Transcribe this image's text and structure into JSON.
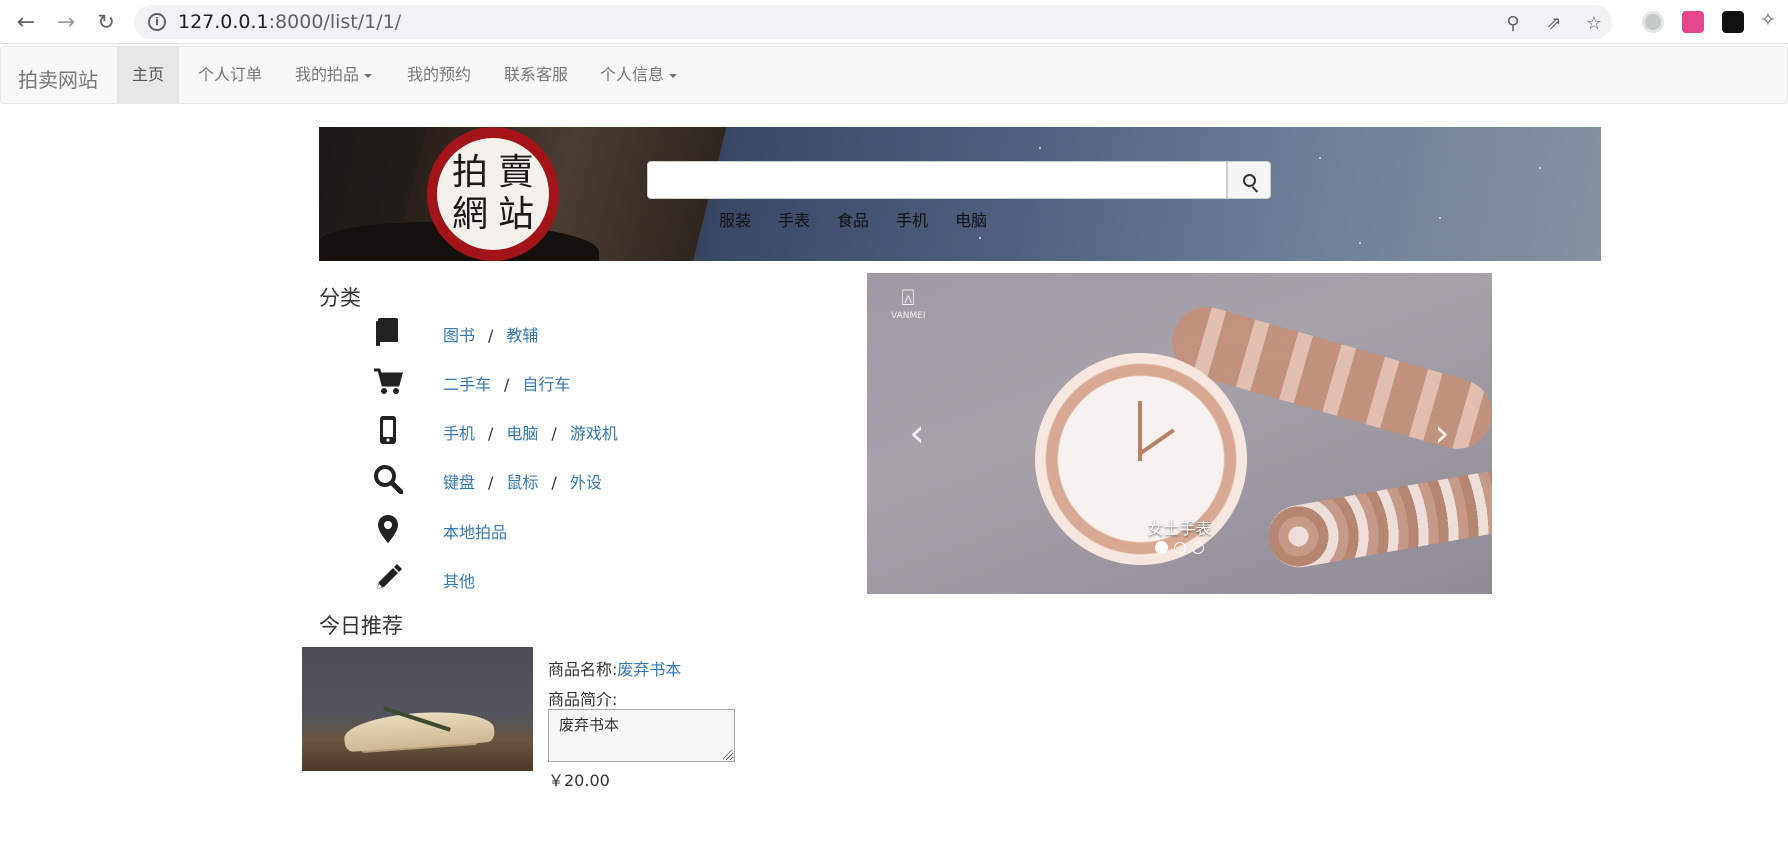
{
  "browser": {
    "url_host": "127.0.0.1",
    "url_rest": ":8000/list/1/1/"
  },
  "navbar": {
    "brand": "拍卖网站",
    "items": [
      {
        "label": "主页",
        "active": true,
        "dropdown": false
      },
      {
        "label": "个人订单",
        "active": false,
        "dropdown": false
      },
      {
        "label": "我的拍品",
        "active": false,
        "dropdown": true
      },
      {
        "label": "我的预约",
        "active": false,
        "dropdown": false
      },
      {
        "label": "联系客服",
        "active": false,
        "dropdown": false
      },
      {
        "label": "个人信息",
        "active": false,
        "dropdown": true
      }
    ]
  },
  "banner": {
    "seal_chars": [
      "拍",
      "賣",
      "網",
      "站"
    ],
    "search_value": "",
    "quick_categories": [
      "服装",
      "手表",
      "食品",
      "手机",
      "电脑"
    ]
  },
  "categories": {
    "title": "分类",
    "rows": [
      {
        "icon": "book-icon",
        "links": [
          "图书",
          "教辅"
        ]
      },
      {
        "icon": "cart-icon",
        "links": [
          "二手车",
          "自行车"
        ]
      },
      {
        "icon": "phone-icon",
        "links": [
          "手机",
          "电脑",
          "游戏机"
        ]
      },
      {
        "icon": "search-icon",
        "links": [
          "键盘",
          "鼠标",
          "外设"
        ]
      },
      {
        "icon": "map-marker-icon",
        "links": [
          "本地拍品"
        ]
      },
      {
        "icon": "pencil-icon",
        "links": [
          "其他"
        ]
      }
    ]
  },
  "carousel": {
    "caption": "女士手表",
    "logo_text": "VANMEI",
    "slides": 3,
    "active_slide": 0
  },
  "recommend": {
    "title": "今日推荐",
    "name_label": "商品名称:",
    "name_value": "废弃书本",
    "desc_label": "商品简介:",
    "desc_value": "废弃书本",
    "price": "￥20.00"
  },
  "colors": {
    "link": "#337ab7",
    "navbar_bg": "#f8f8f8",
    "seal_red": "#a21418"
  }
}
